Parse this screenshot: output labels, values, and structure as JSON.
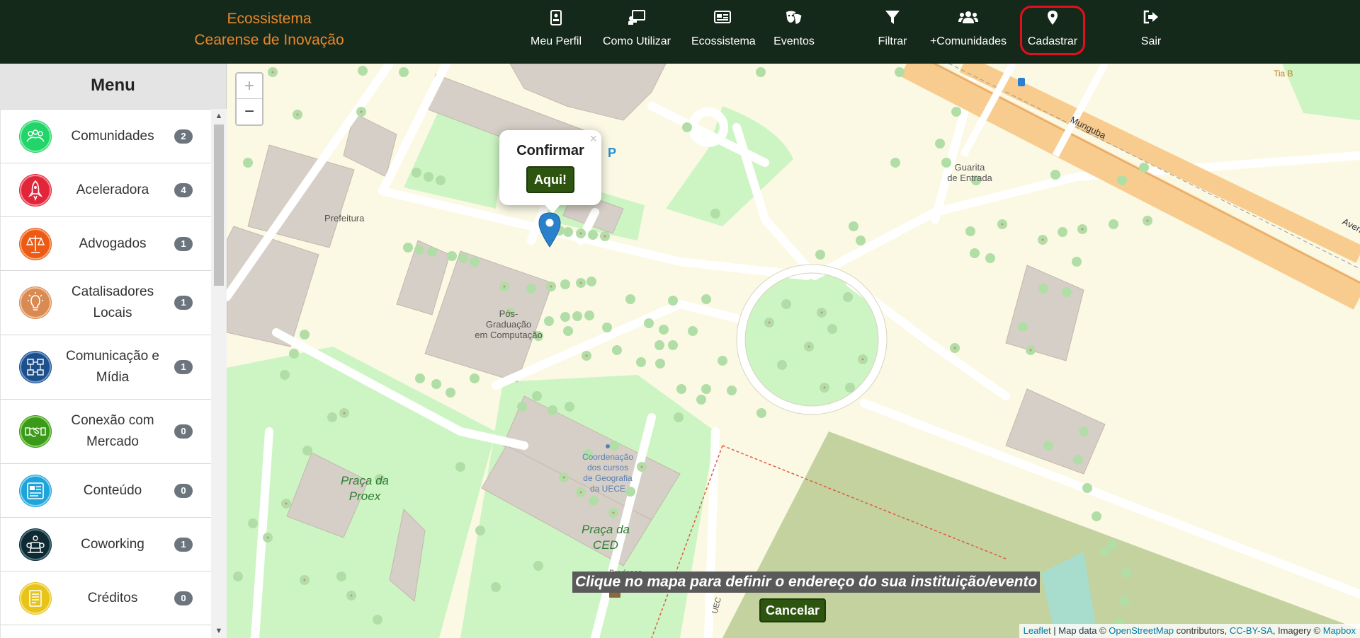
{
  "brand": {
    "line1": "Ecossistema",
    "line2": "Cearense de Inovação"
  },
  "nav": {
    "perfil": "Meu Perfil",
    "como": "Como Utilizar",
    "ecossistema": "Ecossistema",
    "eventos": "Eventos",
    "filtrar": "Filtrar",
    "comunidades": "+Comunidades",
    "cadastrar": "Cadastrar",
    "sair": "Sair",
    "icons": [
      "id-card-icon",
      "chalkboard-teacher-icon",
      "newspaper-icon",
      "theater-masks-icon",
      "filter-icon",
      "users-icon",
      "map-marker-icon",
      "sign-out-icon"
    ],
    "highlight_color": "#e0101e"
  },
  "menu": {
    "title": "Menu",
    "items": [
      {
        "label": "Comunidades",
        "count": "2",
        "icon": "people-group-icon",
        "color": "#22d46a"
      },
      {
        "label": "Aceleradora",
        "count": "4",
        "icon": "rocket-icon",
        "color": "#e2263a"
      },
      {
        "label": "Advogados",
        "count": "1",
        "icon": "scales-icon",
        "color": "#ec5a14"
      },
      {
        "label": "Catalisadores Locais",
        "count": "1",
        "icon": "lightbulb-icon",
        "color": "#d98a52"
      },
      {
        "label": "Comunicação e Mídia",
        "count": "1",
        "icon": "media-network-icon",
        "color": "#1d4f8a"
      },
      {
        "label": "Conexão com Mercado",
        "count": "0",
        "icon": "handshake-icon",
        "color": "#3b9a1a"
      },
      {
        "label": "Conteúdo",
        "count": "0",
        "icon": "content-board-icon",
        "color": "#1ea4d8"
      },
      {
        "label": "Coworking",
        "count": "1",
        "icon": "coworking-icon",
        "color": "#0f2a33"
      },
      {
        "label": "Créditos",
        "count": "0",
        "icon": "credits-icon",
        "color": "#e8c41a"
      }
    ]
  },
  "map": {
    "zoom_in": "+",
    "zoom_out": "−",
    "popup_title": "Confirmar",
    "popup_button": "Aqui!",
    "popup_close": "×",
    "instruction": "Clique no mapa para definir o endereço do sua instituição/evento",
    "cancel": "Cancelar",
    "attribution": {
      "leaflet": "Leaflet",
      "text1": " | Map data © ",
      "osm": "OpenStreetMap",
      "text2": " contributors, ",
      "license": "CC-BY-SA",
      "text3": ", Imagery © ",
      "mapbox": "Mapbox"
    },
    "labels": {
      "prefeitura": "Prefeitura",
      "pos1": "Pós-",
      "pos2": "Graduação",
      "pos3": "em Computação",
      "guarita1": "Guarita",
      "guarita2": "de Entrada",
      "praca_proex1": "Praça da",
      "praca_proex2": "Proex",
      "coord1": "Coordenação",
      "coord2": "dos cursos",
      "coord3": "de Geografia",
      "coord4": "da UECE",
      "praca_ced1": "Praça da",
      "praca_ced2": "CED",
      "bradesco": "Bradesco",
      "munguba": "Munguba",
      "tiab": "Tia B",
      "aven": "Aven",
      "parking": "P",
      "uec": "UEC"
    }
  }
}
